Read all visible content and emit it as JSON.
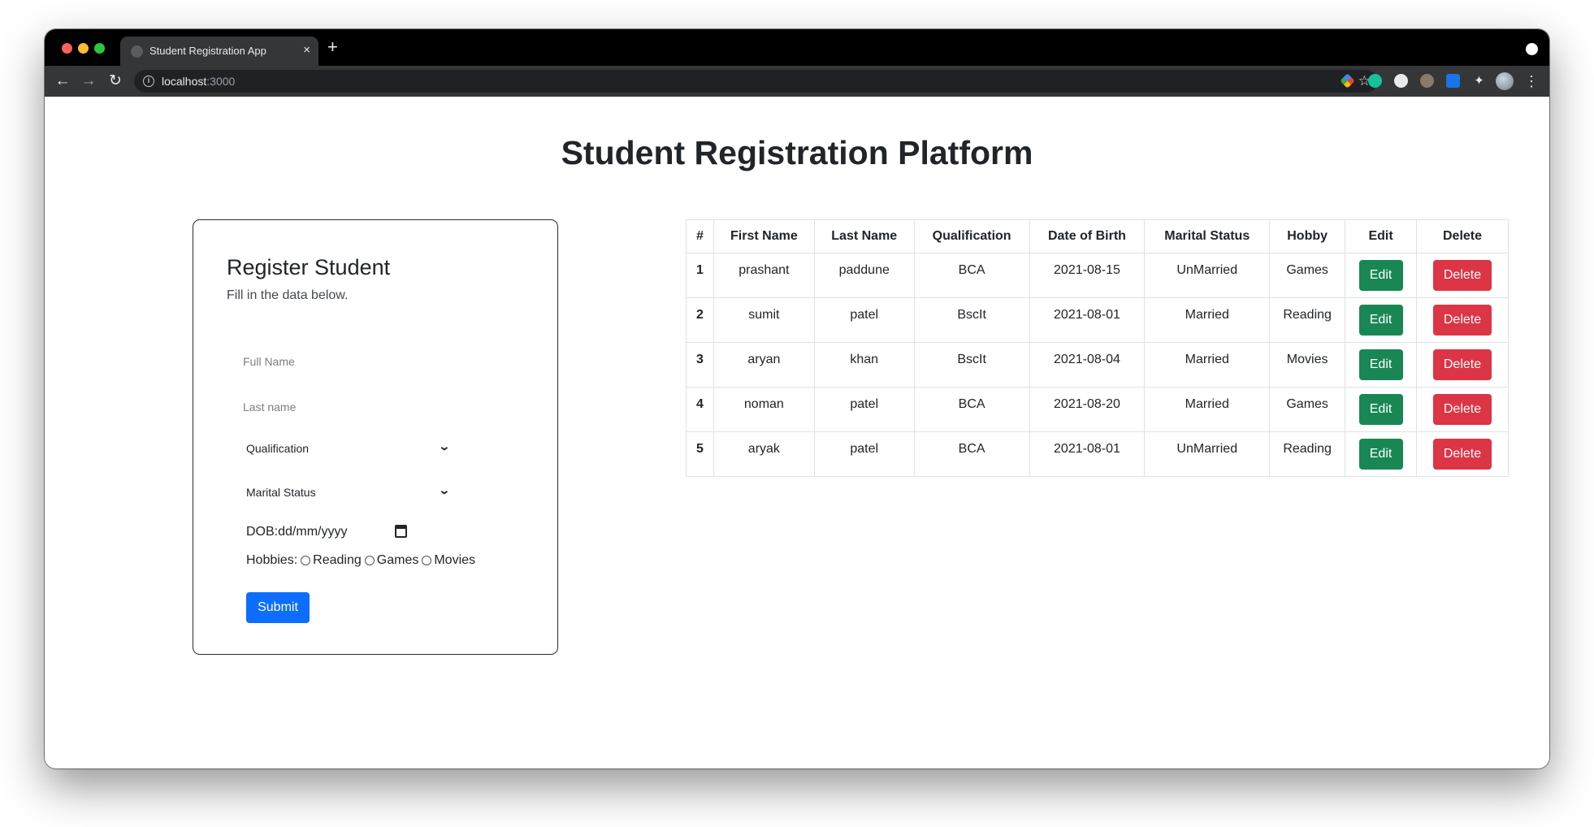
{
  "browser": {
    "tab_title": "Student Registration App",
    "tab_close": "×",
    "new_tab": "+",
    "url_host": "localhost",
    "url_port": ":3000"
  },
  "page": {
    "title": "Student Registration Platform"
  },
  "form": {
    "title": "Register Student",
    "subtitle": "Fill in the data below.",
    "first_name_placeholder": "Full Name",
    "last_name_placeholder": "Last name",
    "qualification_label": "Qualification",
    "marital_label": "Marital Status",
    "dob_placeholder": "DOB:dd/mm/yyyy",
    "hobbies_label": "Hobbies:",
    "hobby_options": [
      "Reading",
      "Games",
      "Movies"
    ],
    "submit_label": "Submit"
  },
  "table": {
    "headers": [
      "#",
      "First Name",
      "Last Name",
      "Qualification",
      "Date of Birth",
      "Marital Status",
      "Hobby",
      "Edit",
      "Delete"
    ],
    "edit_label": "Edit",
    "delete_label": "Delete",
    "rows": [
      {
        "num": "1",
        "first": "prashant",
        "last": "paddune",
        "qualification": "BCA",
        "dob": "2021-08-15",
        "marital": "UnMarried",
        "hobby": "Games"
      },
      {
        "num": "2",
        "first": "sumit",
        "last": "patel",
        "qualification": "BscIt",
        "dob": "2021-08-01",
        "marital": "Married",
        "hobby": "Reading"
      },
      {
        "num": "3",
        "first": "aryan",
        "last": "khan",
        "qualification": "BscIt",
        "dob": "2021-08-04",
        "marital": "Married",
        "hobby": "Movies"
      },
      {
        "num": "4",
        "first": "noman",
        "last": "patel",
        "qualification": "BCA",
        "dob": "2021-08-20",
        "marital": "Married",
        "hobby": "Games"
      },
      {
        "num": "5",
        "first": "aryak",
        "last": "patel",
        "qualification": "BCA",
        "dob": "2021-08-01",
        "marital": "UnMarried",
        "hobby": "Reading"
      }
    ]
  },
  "colors": {
    "primary": "#0d6efd",
    "success": "#198754",
    "danger": "#dc3545"
  }
}
